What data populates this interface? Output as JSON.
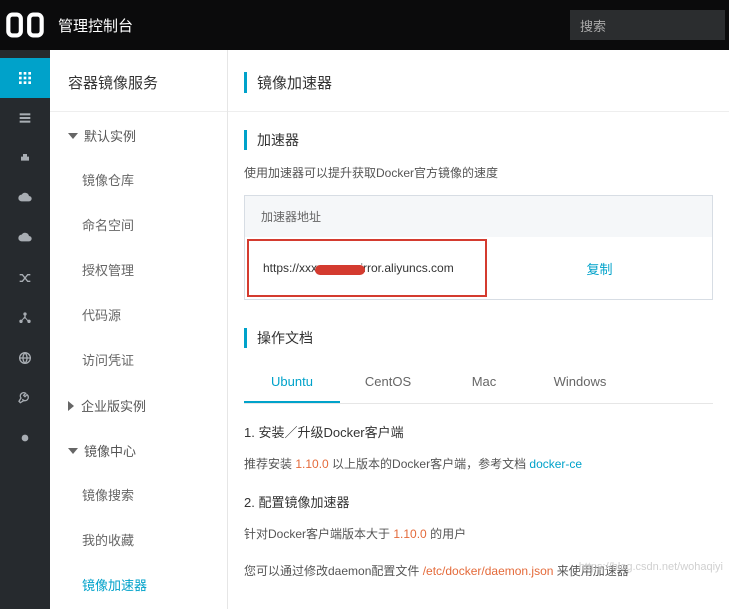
{
  "topbar": {
    "title": "管理控制台",
    "search_placeholder": "搜索"
  },
  "sidebar": {
    "service_title": "容器镜像服务",
    "groups": {
      "default": {
        "label": "默认实例",
        "items": [
          "镜像仓库",
          "命名空间",
          "授权管理",
          "代码源",
          "访问凭证"
        ]
      },
      "enterprise": {
        "label": "企业版实例"
      },
      "center": {
        "label": "镜像中心",
        "items": [
          "镜像搜索",
          "我的收藏",
          "镜像加速器"
        ]
      }
    }
  },
  "page": {
    "title": "镜像加速器",
    "accelerator": {
      "title": "加速器",
      "desc": "使用加速器可以提升获取Docker官方镜像的速度",
      "addr_label": "加速器地址",
      "addr_value": "https://xxxxxxxx.mirror.aliyuncs.com",
      "copy": "复制"
    },
    "docs": {
      "title": "操作文档",
      "tabs": [
        "Ubuntu",
        "CentOS",
        "Mac",
        "Windows"
      ],
      "step1": "1. 安装／升级Docker客户端",
      "rec_prefix": "推荐安装 ",
      "rec_ver": "1.10.0",
      "rec_suffix": " 以上版本的Docker客户端，参考文档 ",
      "rec_link": "docker-ce",
      "step2": "2. 配置镜像加速器",
      "cfg_line1_pre": "针对Docker客户端版本大于 ",
      "cfg_line1_ver": "1.10.0",
      "cfg_line1_post": " 的用户",
      "cfg_line2_pre": "您可以通过修改daemon配置文件 ",
      "cfg_line2_path": "/etc/docker/daemon.json",
      "cfg_line2_post": " 来使用加速器"
    }
  },
  "watermark": "https://blog.csdn.net/wohaqiyi"
}
